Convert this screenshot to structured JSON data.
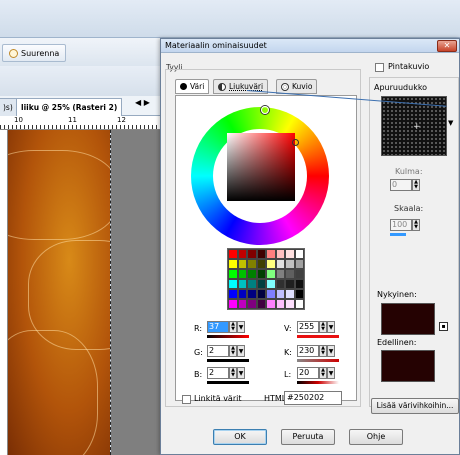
{
  "app": {
    "zoom_label": "Suurenna",
    "tabs": [
      ")s)",
      "liiku @ 25% (Rasteri 2)"
    ],
    "tab_nav": "◀ ▶",
    "ruler_labels": [
      "10",
      "11",
      "12"
    ]
  },
  "dialog": {
    "title": "Materiaalin ominaisuudet",
    "close": "✕",
    "type_label": "Tyyli",
    "tabs": [
      "Väri",
      "Liukuväri",
      "Kuvio"
    ],
    "swatch_colors": [
      "#ff0000",
      "#c00000",
      "#800000",
      "#400000",
      "#ff8080",
      "#ffc0c0",
      "#ffe0e0",
      "#ffffff",
      "#ffff00",
      "#c0c000",
      "#808000",
      "#404000",
      "#ffff80",
      "#e0e0e0",
      "#c0c0c0",
      "#a0a0a0",
      "#00ff00",
      "#00c000",
      "#008000",
      "#004000",
      "#80ff80",
      "#808080",
      "#606060",
      "#404040",
      "#00ffff",
      "#00c0c0",
      "#008080",
      "#004040",
      "#80ffff",
      "#303030",
      "#202020",
      "#101010",
      "#0000ff",
      "#0000c0",
      "#000080",
      "#000040",
      "#8080ff",
      "#c0c0ff",
      "#e0e0ff",
      "#000000",
      "#ff00ff",
      "#c000c0",
      "#800080",
      "#400040",
      "#ff80ff",
      "#ffc0ff",
      "#ffe0ff",
      "#ffffff"
    ],
    "fields": {
      "r_label": "R:",
      "r_value": "37",
      "g_label": "G:",
      "g_value": "2",
      "b_label": "B:",
      "b_value": "2",
      "v_label": "V:",
      "v_value": "255",
      "k_label": "K:",
      "k_value": "230",
      "l_label": "L:",
      "l_value": "20"
    },
    "link_colors_label": "Linkitä värit",
    "html_label": "HTML:",
    "html_value": "#250202",
    "texture_label": "Pintakuvio",
    "helper_grid_label": "Apuruudukko",
    "angle_label": "Kulma:",
    "angle_value": "0",
    "scale_label": "Skaala:",
    "scale_value": "100",
    "current_label": "Nykyinen:",
    "previous_label": "Edellinen:",
    "current_color": "#250202",
    "previous_color": "#250202",
    "add_swatches_label": "Lisää värivihkoihin...",
    "ok_label": "OK",
    "cancel_label": "Peruuta",
    "help_label": "Ohje"
  }
}
